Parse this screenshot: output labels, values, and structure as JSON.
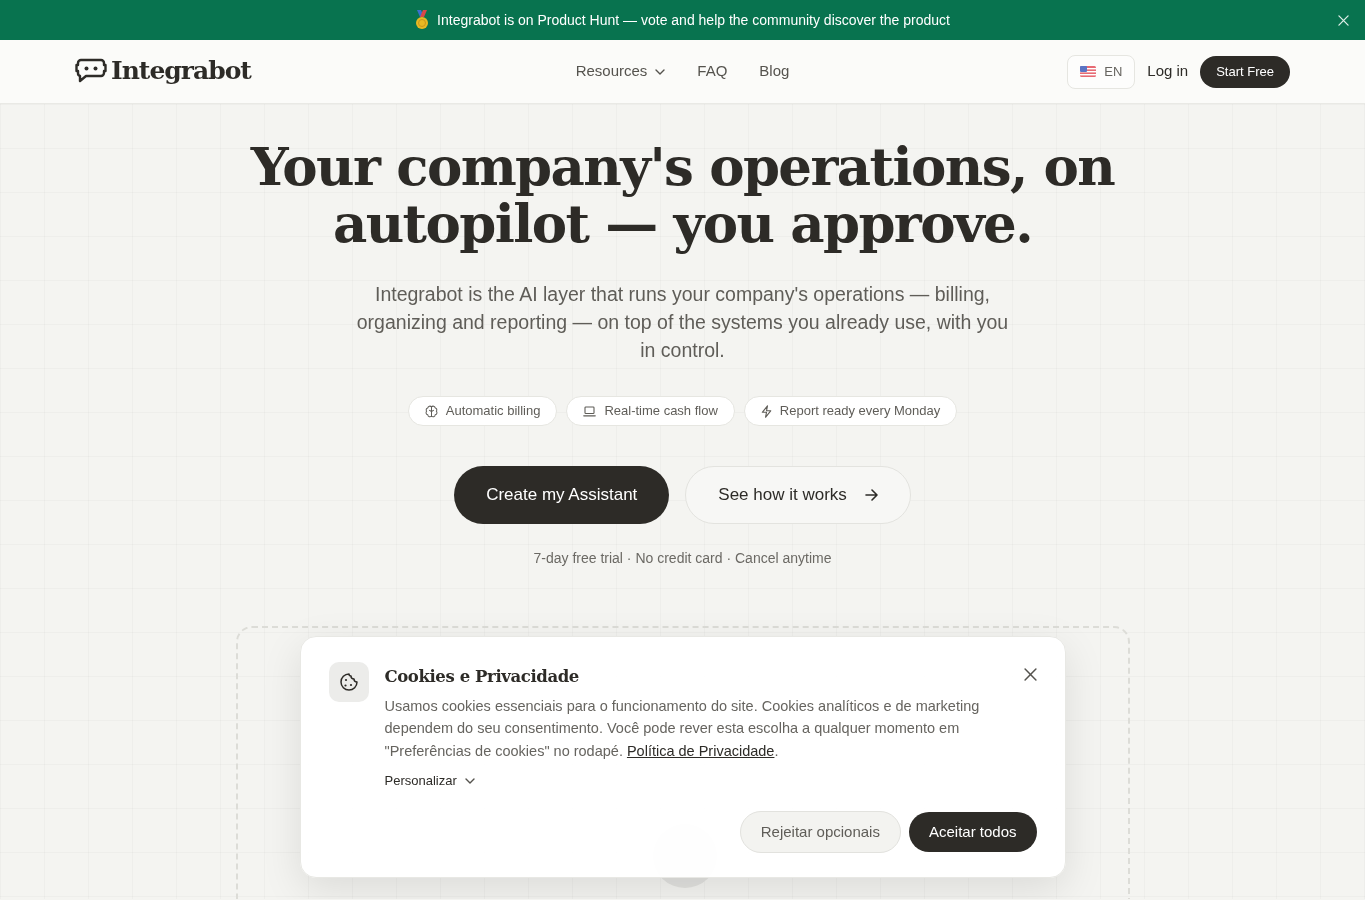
{
  "announcement": {
    "text": "Integrabot is on Product Hunt — vote and help the community discover the product"
  },
  "navbar": {
    "brand": "Integrabot",
    "links": [
      {
        "label": "Resources",
        "kind": "dropdown"
      },
      {
        "label": "FAQ",
        "kind": "link"
      },
      {
        "label": "Blog",
        "kind": "link"
      }
    ],
    "language": "EN",
    "login": "Log in",
    "cta": "Start Free"
  },
  "hero": {
    "title": "Your company's operations, on autopilot — you approve.",
    "subtitle": "Integrabot is the AI layer that runs your company's operations — billing, organizing and reporting — on top of the systems you already use, with you in control.",
    "chips": [
      {
        "label": "Automatic billing"
      },
      {
        "label": "Real-time cash flow"
      },
      {
        "label": "Report ready every Monday"
      }
    ],
    "buttons": [
      {
        "label": "Create my Assistant",
        "kind": "primary"
      },
      {
        "label": "See how it works",
        "kind": "secondary"
      }
    ],
    "note": "7-day free trial · No credit card · Cancel anytime"
  },
  "cookie_dialog": {
    "title": "Cookies e Privacidade",
    "text": "Usamos cookies essenciais para o funcionamento do site. Cookies analíticos e de marketing dependem do seu consentimento. Você pode rever esta escolha a qualquer momento em \"Preferências de cookies\" no rodapé.",
    "link": "Política de Privacidade",
    "text_end": ".",
    "customize": "Personalizar",
    "buttons": [
      {
        "label": "Rejeitar opcionais",
        "kind": "secondary"
      },
      {
        "label": "Aceitar todos",
        "kind": "primary"
      }
    ]
  }
}
